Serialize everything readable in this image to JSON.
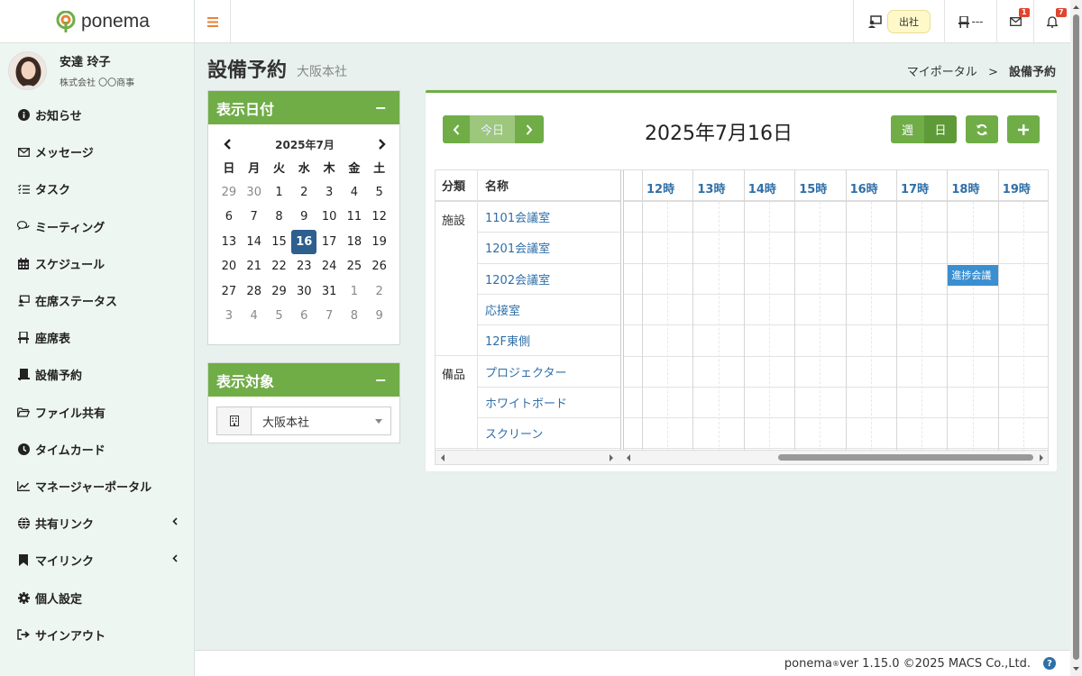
{
  "app": {
    "name": "ponema"
  },
  "user": {
    "name": "安達 玲子",
    "company": "株式会社 〇〇商事"
  },
  "sidebar": {
    "items": [
      {
        "label": "お知らせ",
        "icon": "info-icon"
      },
      {
        "label": "メッセージ",
        "icon": "envelope-icon"
      },
      {
        "label": "タスク",
        "icon": "tasks-icon"
      },
      {
        "label": "ミーティング",
        "icon": "chat-icon"
      },
      {
        "label": "スケジュール",
        "icon": "calendar-icon"
      },
      {
        "label": "在席ステータス",
        "icon": "presence-icon"
      },
      {
        "label": "座席表",
        "icon": "seat-icon"
      },
      {
        "label": "設備予約",
        "icon": "equipment-icon"
      },
      {
        "label": "ファイル共有",
        "icon": "folder-icon"
      },
      {
        "label": "タイムカード",
        "icon": "clock-icon"
      },
      {
        "label": "マネージャーポータル",
        "icon": "chart-icon"
      },
      {
        "label": "共有リンク",
        "icon": "globe-icon"
      },
      {
        "label": "マイリンク",
        "icon": "bookmark-icon"
      },
      {
        "label": "個人設定",
        "icon": "gear-icon"
      },
      {
        "label": "サインアウト",
        "icon": "signout-icon"
      }
    ]
  },
  "topbar": {
    "status": "出社",
    "seat": "---",
    "mail_count": "1",
    "notif_count": "7"
  },
  "page": {
    "title": "設備予約",
    "subtitle": "大阪本社",
    "breadcrumb_home": "マイポータル",
    "breadcrumb_sep": ">",
    "breadcrumb_current": "設備予約"
  },
  "date_panel": {
    "title": "表示日付",
    "collapse": "−",
    "month_label": "2025年7月",
    "weekdays": [
      "日",
      "月",
      "火",
      "水",
      "木",
      "金",
      "土"
    ],
    "weeks": [
      [
        "29",
        "30",
        "1",
        "2",
        "3",
        "4",
        "5"
      ],
      [
        "6",
        "7",
        "8",
        "9",
        "10",
        "11",
        "12"
      ],
      [
        "13",
        "14",
        "15",
        "16",
        "17",
        "18",
        "19"
      ],
      [
        "20",
        "21",
        "22",
        "23",
        "24",
        "25",
        "26"
      ],
      [
        "27",
        "28",
        "29",
        "30",
        "31",
        "1",
        "2"
      ],
      [
        "3",
        "4",
        "5",
        "6",
        "7",
        "8",
        "9"
      ]
    ],
    "selected": "16"
  },
  "target_panel": {
    "title": "表示対象",
    "collapse": "−",
    "selected": "大阪本社"
  },
  "schedule": {
    "today_label": "今日",
    "date_title": "2025年7月16日",
    "view_week": "週",
    "view_day": "日",
    "col_category": "分類",
    "col_name": "名称",
    "hours": [
      "12時",
      "13時",
      "14時",
      "15時",
      "16時",
      "17時",
      "18時",
      "19時"
    ],
    "rows": [
      {
        "category": "施設",
        "name": "1101会議室"
      },
      {
        "category": "",
        "name": "1201会議室"
      },
      {
        "category": "",
        "name": "1202会議室"
      },
      {
        "category": "",
        "name": "応接室"
      },
      {
        "category": "",
        "name": "12F東側"
      },
      {
        "category": "備品",
        "name": "プロジェクター"
      },
      {
        "category": "",
        "name": "ホワイトボード"
      },
      {
        "category": "",
        "name": "スクリーン"
      }
    ],
    "events": [
      {
        "row": 2,
        "title": "進捗会議",
        "start": "18:00",
        "end": "19:00"
      }
    ]
  },
  "footer": {
    "product": "ponema",
    "reg": "®",
    "version": " ver 1.15.0 ©2025 MACS Co.,Ltd.",
    "help": "?"
  },
  "colors": {
    "accent": "#70ad47",
    "selected_day": "#2d5f8f",
    "link": "#2f6fa8",
    "event": "#3a8fd0"
  }
}
